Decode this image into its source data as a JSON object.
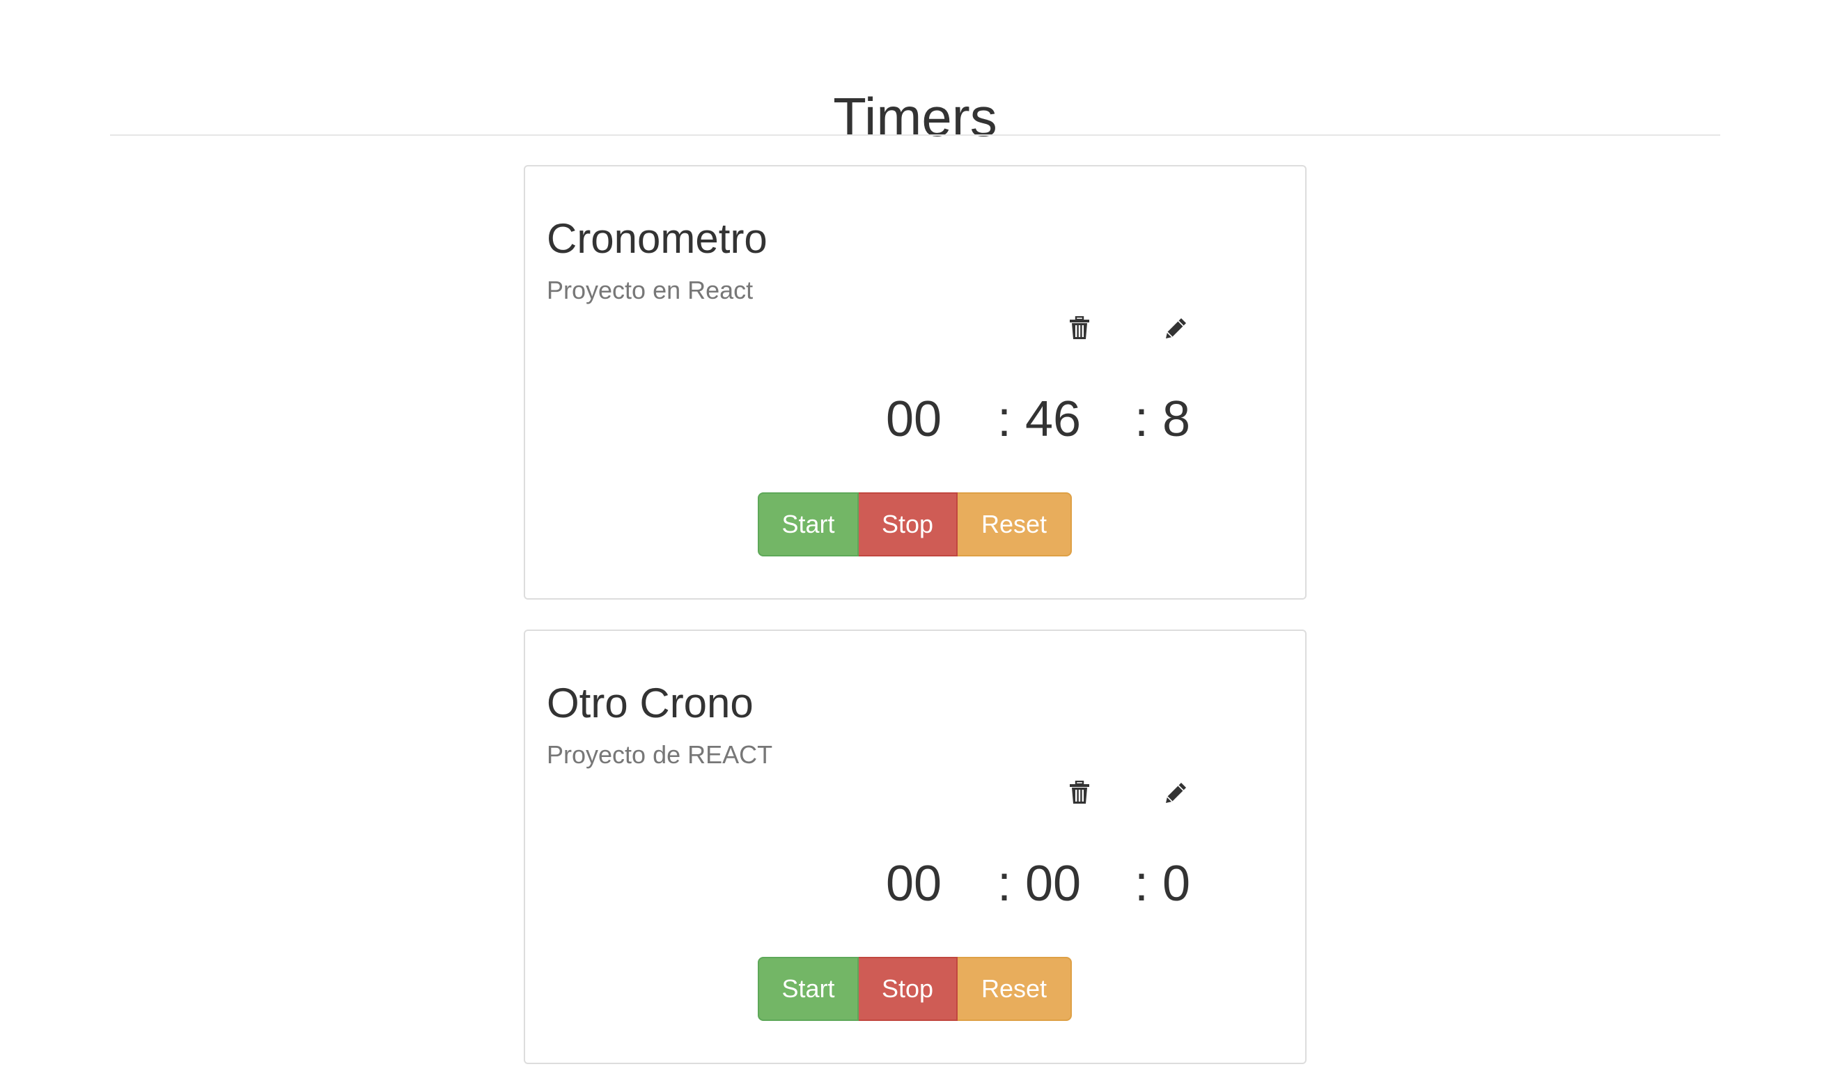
{
  "page": {
    "title": "Timers"
  },
  "timers": [
    {
      "title": "Cronometro",
      "project": "Proyecto en React",
      "hours": "00",
      "minutes": ": 46",
      "seconds": ": 8",
      "delete_icon": "trash-icon",
      "edit_icon": "pencil-icon",
      "start_label": "Start",
      "stop_label": "Stop",
      "reset_label": "Reset"
    },
    {
      "title": "Otro Crono",
      "project": "Proyecto de REACT",
      "hours": "00",
      "minutes": ": 00",
      "seconds": ": 0",
      "delete_icon": "trash-icon",
      "edit_icon": "pencil-icon",
      "start_label": "Start",
      "stop_label": "Stop",
      "reset_label": "Reset"
    }
  ],
  "colors": {
    "start": "#73b666",
    "stop": "#cf5c55",
    "reset": "#e8ad5c",
    "text": "#333333",
    "muted_text": "#777777",
    "card_border": "#dddddd"
  }
}
